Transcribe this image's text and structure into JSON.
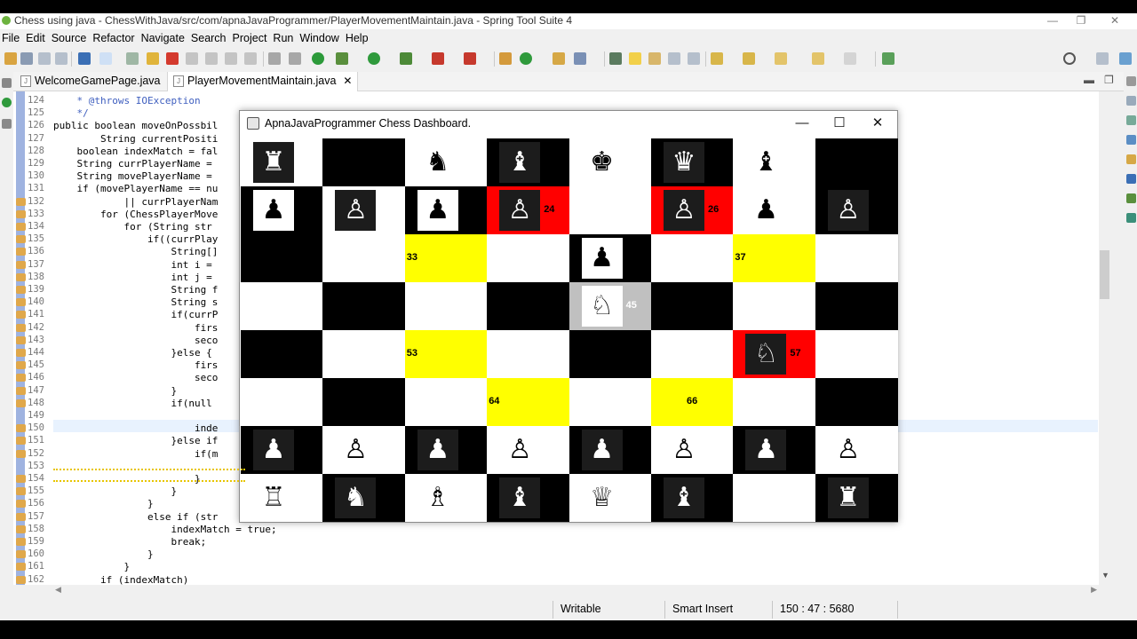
{
  "window": {
    "title": "Chess using java - ChessWithJava/src/com/apnaJavaProgrammer/PlayerMovementMaintain.java - Spring Tool Suite 4"
  },
  "menu": [
    "File",
    "Edit",
    "Source",
    "Refactor",
    "Navigate",
    "Search",
    "Project",
    "Run",
    "Window",
    "Help"
  ],
  "tabs": [
    {
      "label": "WelcomeGamePage.java"
    },
    {
      "label": "PlayerMovementMaintain.java"
    }
  ],
  "tab_close": "✕",
  "code": {
    "line_numbers": [
      "124",
      "125",
      "126",
      "127",
      "128",
      "129",
      "130",
      "131",
      "132",
      "133",
      "134",
      "135",
      "136",
      "137",
      "138",
      "139",
      "140",
      "141",
      "142",
      "143",
      "144",
      "145",
      "146",
      "147",
      "148",
      "149",
      "150",
      "151",
      "152",
      "153",
      "154",
      "155",
      "156",
      "157",
      "158",
      "159",
      "160",
      "161",
      "162"
    ],
    "lines": [
      "    * @throws IOException",
      "    */",
      "public boolean moveOnPossbil",
      "        String currentPositi",
      "    boolean indexMatch = fal",
      "    String currPlayerName = ",
      "    String movePlayerName = ",
      "    if (movePlayerName == nu",
      "            || currPlayerNam",
      "        for (ChessPlayerMove",
      "            for (String str ",
      "                if((currPlay",
      "                    String[]",
      "                    int i = ",
      "                    int j = ",
      "                    String f",
      "                    String s",
      "                    if(currP",
      "                        firs",
      "                        seco",
      "                    }else {",
      "                        firs",
      "                        seco",
      "                    }",
      "                    if(null ",
      "",
      "                        inde",
      "                    }else if",
      "                        if(m",
      "",
      "                        }",
      "                    }",
      "                }",
      "                else if (str",
      "                    indexMatch = true;",
      "                    break;",
      "                }",
      "            }",
      "        if (indexMatch)"
    ]
  },
  "status": {
    "writable": "Writable",
    "insert_mode": "Smart Insert",
    "position": "150 : 47 : 5680"
  },
  "chess": {
    "title": "ApnaJavaProgrammer Chess Dashboard.",
    "controls": {
      "minimize": "—",
      "maximize": "☐",
      "close": "✕"
    },
    "board": [
      [
        {
          "bg": "#ffffff",
          "piece": "♜",
          "pbg": "dark",
          "glyph_color": "#ffffff"
        },
        {
          "bg": "#000000",
          "piece": "",
          "pbg": "none"
        },
        {
          "bg": "#ffffff",
          "piece": "♞",
          "pbg": "none",
          "glyph_color": "#000000"
        },
        {
          "bg": "#000000",
          "piece": "♝",
          "pbg": "dark",
          "glyph_color": "#ffffff"
        },
        {
          "bg": "#ffffff",
          "piece": "♚",
          "pbg": "none",
          "glyph_color": "#000000"
        },
        {
          "bg": "#000000",
          "piece": "♛",
          "pbg": "dark",
          "glyph_color": "#ffffff"
        },
        {
          "bg": "#ffffff",
          "piece": "♝",
          "pbg": "none",
          "glyph_color": "#000000"
        },
        {
          "bg": "#000000",
          "piece": "",
          "pbg": "none"
        },
        {
          "bg": "#ffffff",
          "piece": "♜",
          "pbg": "none",
          "glyph_color": "#000000"
        }
      ],
      [
        {
          "bg": "#000000",
          "piece": "♟",
          "pbg": "white",
          "glyph_color": "#000000"
        },
        {
          "bg": "#ffffff",
          "piece": "♙",
          "pbg": "dark",
          "glyph_color": "#ffffff"
        },
        {
          "bg": "#000000",
          "piece": "♟",
          "pbg": "white",
          "glyph_color": "#000000"
        },
        {
          "bg": "#ff0000",
          "piece": "♙",
          "pbg": "dark",
          "glyph_color": "#ffffff",
          "label": "24"
        },
        {
          "bg": "#ffffff",
          "piece": "",
          "pbg": "none"
        },
        {
          "bg": "#ff0000",
          "piece": "♙",
          "pbg": "dark",
          "glyph_color": "#ffffff",
          "label": "26"
        },
        {
          "bg": "#ffffff",
          "piece": "♟",
          "pbg": "none",
          "glyph_color": "#000000"
        },
        {
          "bg": "#000000",
          "piece": "♙",
          "pbg": "dark",
          "glyph_color": "#ffffff"
        }
      ],
      [
        {
          "bg": "#000000",
          "piece": "",
          "pbg": "none"
        },
        {
          "bg": "#ffffff",
          "piece": "",
          "pbg": "none"
        },
        {
          "bg": "#ffff00",
          "piece": "",
          "pbg": "none",
          "label": "33"
        },
        {
          "bg": "#ffffff",
          "piece": "",
          "pbg": "none"
        },
        {
          "bg": "#000000",
          "piece": "♟",
          "pbg": "white",
          "glyph_color": "#000000"
        },
        {
          "bg": "#ffffff",
          "piece": "",
          "pbg": "none"
        },
        {
          "bg": "#ffff00",
          "piece": "",
          "pbg": "none",
          "label": "37"
        },
        {
          "bg": "#ffffff",
          "piece": "",
          "pbg": "none"
        }
      ],
      [
        {
          "bg": "#ffffff",
          "piece": "",
          "pbg": "none"
        },
        {
          "bg": "#000000",
          "piece": "",
          "pbg": "none"
        },
        {
          "bg": "#ffffff",
          "piece": "",
          "pbg": "none"
        },
        {
          "bg": "#000000",
          "piece": "",
          "pbg": "none"
        },
        {
          "bg": "#c0c0c0",
          "piece": "♘",
          "pbg": "white",
          "glyph_color": "#000000",
          "label": "45",
          "label_color": "#ffffff"
        },
        {
          "bg": "#000000",
          "piece": "",
          "pbg": "none"
        },
        {
          "bg": "#ffffff",
          "piece": "",
          "pbg": "none"
        },
        {
          "bg": "#000000",
          "piece": "",
          "pbg": "none"
        }
      ],
      [
        {
          "bg": "#000000",
          "piece": "",
          "pbg": "none"
        },
        {
          "bg": "#ffffff",
          "piece": "",
          "pbg": "none"
        },
        {
          "bg": "#ffff00",
          "piece": "",
          "pbg": "none",
          "label": "53"
        },
        {
          "bg": "#ffffff",
          "piece": "",
          "pbg": "none"
        },
        {
          "bg": "#000000",
          "piece": "",
          "pbg": "none"
        },
        {
          "bg": "#ffffff",
          "piece": "",
          "pbg": "none"
        },
        {
          "bg": "#ff0000",
          "piece": "♘",
          "pbg": "dark",
          "glyph_color": "#ffffff",
          "label": "57"
        },
        {
          "bg": "#ffffff",
          "piece": "",
          "pbg": "none"
        }
      ],
      [
        {
          "bg": "#ffffff",
          "piece": "",
          "pbg": "none"
        },
        {
          "bg": "#000000",
          "piece": "",
          "pbg": "none"
        },
        {
          "bg": "#ffffff",
          "piece": "",
          "pbg": "none"
        },
        {
          "bg": "#ffff00",
          "piece": "",
          "pbg": "none",
          "label": "64"
        },
        {
          "bg": "#ffffff",
          "piece": "",
          "pbg": "none"
        },
        {
          "bg": "#ffff00",
          "piece": "",
          "pbg": "none",
          "label": "66"
        },
        {
          "bg": "#ffffff",
          "piece": "",
          "pbg": "none"
        },
        {
          "bg": "#000000",
          "piece": "",
          "pbg": "none"
        }
      ],
      [
        {
          "bg": "#000000",
          "piece": "♟",
          "pbg": "dark",
          "glyph_color": "#ffffff"
        },
        {
          "bg": "#ffffff",
          "piece": "♙",
          "pbg": "none",
          "glyph_color": "#000000"
        },
        {
          "bg": "#000000",
          "piece": "♟",
          "pbg": "dark",
          "glyph_color": "#ffffff"
        },
        {
          "bg": "#ffffff",
          "piece": "♙",
          "pbg": "none",
          "glyph_color": "#000000"
        },
        {
          "bg": "#000000",
          "piece": "♟",
          "pbg": "dark",
          "glyph_color": "#ffffff"
        },
        {
          "bg": "#ffffff",
          "piece": "♙",
          "pbg": "none",
          "glyph_color": "#000000"
        },
        {
          "bg": "#000000",
          "piece": "♟",
          "pbg": "dark",
          "glyph_color": "#ffffff"
        },
        {
          "bg": "#ffffff",
          "piece": "♙",
          "pbg": "none",
          "glyph_color": "#000000"
        }
      ],
      [
        {
          "bg": "#ffffff",
          "piece": "♖",
          "pbg": "none",
          "glyph_color": "#000000"
        },
        {
          "bg": "#000000",
          "piece": "♞",
          "pbg": "dark",
          "glyph_color": "#ffffff"
        },
        {
          "bg": "#ffffff",
          "piece": "♗",
          "pbg": "none",
          "glyph_color": "#000000"
        },
        {
          "bg": "#000000",
          "piece": "♝",
          "pbg": "dark",
          "glyph_color": "#ffffff"
        },
        {
          "bg": "#ffffff",
          "piece": "♕",
          "pbg": "none",
          "glyph_color": "#000000"
        },
        {
          "bg": "#000000",
          "piece": "♝",
          "pbg": "dark",
          "glyph_color": "#ffffff"
        },
        {
          "bg": "#ffffff",
          "piece": "",
          "pbg": "none"
        },
        {
          "bg": "#000000",
          "piece": "♜",
          "pbg": "dark",
          "glyph_color": "#ffffff"
        }
      ]
    ]
  }
}
